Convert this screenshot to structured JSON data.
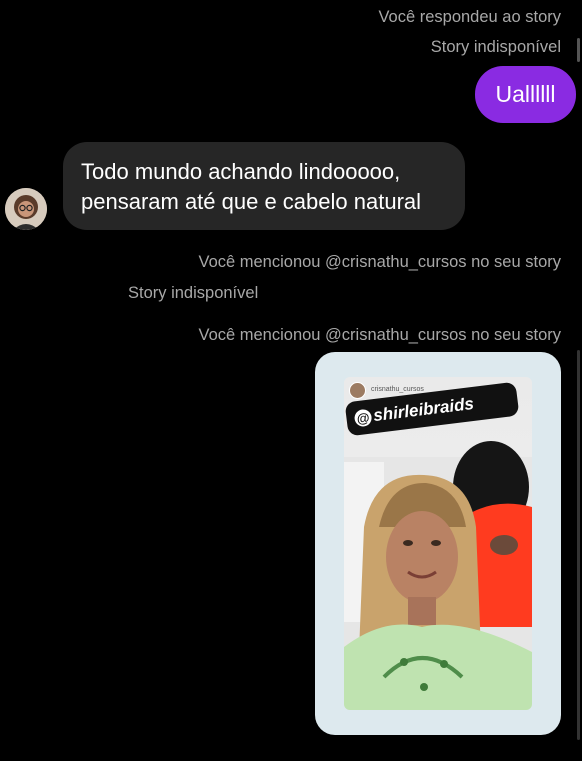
{
  "thread": {
    "reply_note": "Você respondeu ao story",
    "story_unavailable_1": "Story indisponível",
    "outgoing_message": "Uallllll",
    "incoming_message_line1": "Todo mundo achando lindooooo,",
    "incoming_message_line2": "pensaram até que e cabelo natural",
    "mention_note_1": "Você mencionou @crisnathu_cursos no seu story",
    "story_unavailable_2": "Story indisponível",
    "mention_note_2": "Você mencionou @crisnathu_cursos no seu story"
  },
  "story_preview": {
    "account": "crisnathu_cursos",
    "mention_sticker": "shirleibraids",
    "mention_symbol": "@"
  },
  "colors": {
    "background": "#000000",
    "outgoing_bubble": "#8a2be2",
    "incoming_bubble": "#262626",
    "meta_text": "#a8a8a8",
    "story_card": "#dde9ee"
  }
}
